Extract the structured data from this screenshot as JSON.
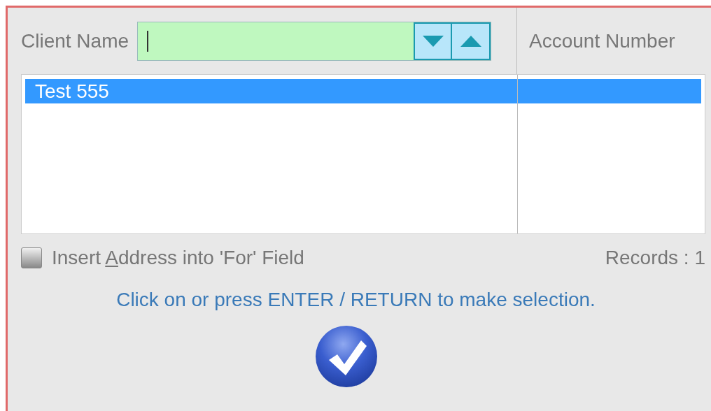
{
  "search": {
    "label": "Client Name"
  },
  "columns": [
    {
      "label": "Account Number"
    }
  ],
  "rows": [
    {
      "client": "Test 555",
      "selected": true
    }
  ],
  "option": {
    "label_before": "Insert ",
    "accelerator": "A",
    "label_after": "ddress into 'For' Field",
    "checked": false
  },
  "records": "Records : 1",
  "hint": "Click on or press ENTER / RETURN to make selection."
}
